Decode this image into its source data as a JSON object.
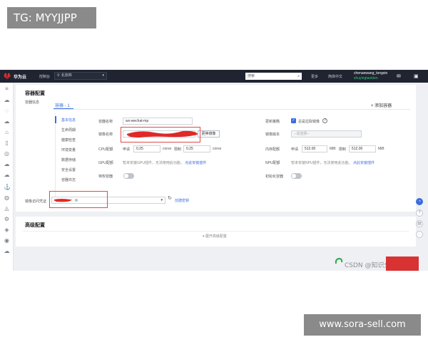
{
  "overlay": {
    "tg_label": "TG: MYYJJPP",
    "site_label": "www.sora-sell.com"
  },
  "topbar": {
    "brand": "华为云",
    "console": "控制台",
    "region": "北京四",
    "search_placeholder": "搜索",
    "more": "更多",
    "language": "简体中文",
    "username": "chenanwang_tongxin",
    "account": "shuyingtaoiden"
  },
  "container_config": {
    "title": "容器配置",
    "subtitle": "容器信息",
    "tab": "容器 - 1",
    "add_container": "+ 添加容器",
    "subnav": [
      "基本信息",
      "生命周期",
      "健康检查",
      "环境变量",
      "数据存储",
      "安全设置",
      "容器日志"
    ],
    "fields": {
      "container_name_label": "容器名称",
      "container_name_value": "wx-wechat-mp",
      "image_name_label": "镜像名称",
      "change_image_button": "更换镜像",
      "cpu_quota_label": "CPU配额",
      "cpu_request_label": "申请",
      "cpu_request_value": "0.25",
      "cpu_unit": "cores",
      "cpu_limit_label": "限制",
      "cpu_limit_value": "0.25",
      "gpu_quota_label": "GPU配额",
      "gpu_hint": "暂未安装GPU插件，无法使用此功能。",
      "gpu_hint_link": "点此安装插件",
      "privileged_label": "特权容器",
      "update_strategy_label": "更新策略",
      "always_pull_label": "总是拉取镜像",
      "image_tag_label": "镜像版本",
      "image_tag_placeholder": "--请选择--",
      "memory_quota_label": "内存配额",
      "mem_request_label": "申请",
      "mem_request_value": "512.00",
      "mem_unit": "MiB",
      "mem_limit_label": "限制",
      "mem_limit_value": "512.00",
      "npu_quota_label": "NPU配额",
      "npu_hint": "暂未安装NPU插件，无法使用此功能。",
      "npu_hint_link": "点此安装插件",
      "init_container_label": "初始化容器"
    },
    "secret_label": "镜像访问凭证",
    "secret_link": "创建密钥"
  },
  "advanced_config": {
    "title": "高级配置",
    "expand": "展开高级配置"
  },
  "watermark": "CSDN @知识分享1985",
  "colors": {
    "accent": "#3b6de0",
    "topbar": "#1f2430",
    "highlight": "#e04a4a"
  }
}
